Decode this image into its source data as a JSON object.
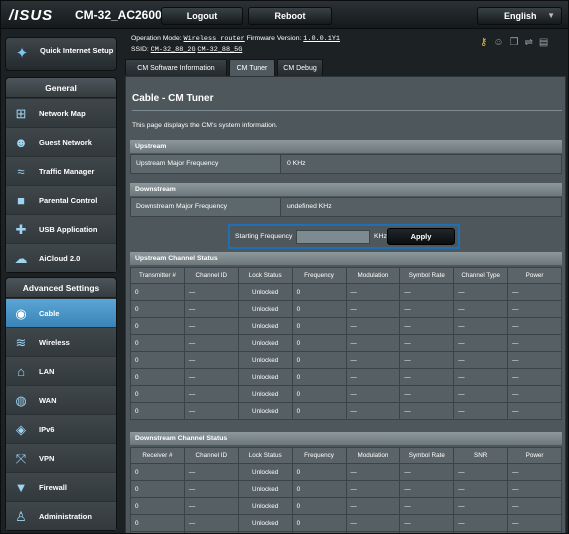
{
  "topbar": {
    "logo": "/ISUS",
    "model": "CM-32_AC2600",
    "logout": "Logout",
    "reboot": "Reboot",
    "language": "English"
  },
  "info": {
    "op_mode_label": "Operation Mode:",
    "op_mode_value": "Wireless router",
    "firmware_label": "Firmware Version:",
    "firmware_value": "1.0.0.1Y1",
    "ssid_label": "SSID:",
    "ssid_24": "CM-32_88_2G",
    "ssid_5": "CM-32_88_5G"
  },
  "nav": {
    "quick_setup": "Quick Internet Setup",
    "general_header": "General",
    "general": [
      {
        "label": "Network Map",
        "icon": "network-map-icon",
        "glyph": "⊞"
      },
      {
        "label": "Guest Network",
        "icon": "guest-network-icon",
        "glyph": "☻"
      },
      {
        "label": "Traffic Manager",
        "icon": "traffic-manager-icon",
        "glyph": "≈"
      },
      {
        "label": "Parental Control",
        "icon": "lock-icon",
        "glyph": "■"
      },
      {
        "label": "USB Application",
        "icon": "puzzle-icon",
        "glyph": "✚"
      },
      {
        "label": "AiCloud 2.0",
        "icon": "cloud-icon",
        "glyph": "☁"
      }
    ],
    "advanced_header": "Advanced Settings",
    "advanced": [
      {
        "label": "Cable",
        "icon": "cable-icon",
        "glyph": "◉",
        "active": true
      },
      {
        "label": "Wireless",
        "icon": "wireless-icon",
        "glyph": "≋"
      },
      {
        "label": "LAN",
        "icon": "home-icon",
        "glyph": "⌂"
      },
      {
        "label": "WAN",
        "icon": "globe-icon",
        "glyph": "◍"
      },
      {
        "label": "IPv6",
        "icon": "ipv6-icon",
        "glyph": "◈"
      },
      {
        "label": "VPN",
        "icon": "vpn-icon",
        "glyph": "⤧"
      },
      {
        "label": "Firewall",
        "icon": "shield-icon",
        "glyph": "▼"
      },
      {
        "label": "Administration",
        "icon": "person-icon",
        "glyph": "♙"
      }
    ]
  },
  "tabs": [
    "CM Software Information",
    "CM Tuner",
    "CM Debug"
  ],
  "page": {
    "title": "Cable - CM Tuner",
    "description": "This page displays the CM's system information.",
    "upstream_header": "Upstream",
    "upstream_label": "Upstream Major Frequency",
    "upstream_value": "0 KHz",
    "downstream_header": "Downstream",
    "downstream_label": "Downstream Major Frequency",
    "downstream_value": "undefined KHz",
    "starting_freq_label": "Starting Frequency",
    "starting_freq_value": "",
    "freq_unit": "KHz",
    "apply": "Apply"
  },
  "upstream_table": {
    "title": "Upstream Channel Status",
    "columns": [
      "Transmitter #",
      "Channel ID",
      "Lock Status",
      "Frequency",
      "Modulation",
      "Symbol Rate",
      "Channel Type",
      "Power"
    ],
    "rows": [
      [
        "0",
        "—",
        "Unlocked",
        "0",
        "—",
        "—",
        "—",
        "—"
      ],
      [
        "0",
        "—",
        "Unlocked",
        "0",
        "—",
        "—",
        "—",
        "—"
      ],
      [
        "0",
        "—",
        "Unlocked",
        "0",
        "—",
        "—",
        "—",
        "—"
      ],
      [
        "0",
        "—",
        "Unlocked",
        "0",
        "—",
        "—",
        "—",
        "—"
      ],
      [
        "0",
        "—",
        "Unlocked",
        "0",
        "—",
        "—",
        "—",
        "—"
      ],
      [
        "0",
        "—",
        "Unlocked",
        "0",
        "—",
        "—",
        "—",
        "—"
      ],
      [
        "0",
        "—",
        "Unlocked",
        "0",
        "—",
        "—",
        "—",
        "—"
      ],
      [
        "0",
        "—",
        "Unlocked",
        "0",
        "—",
        "—",
        "—",
        "—"
      ]
    ]
  },
  "downstream_table": {
    "title": "Downstream Channel Status",
    "columns": [
      "Receiver #",
      "Channel ID",
      "Lock Status",
      "Frequency",
      "Modulation",
      "Symbol Rate",
      "SNR",
      "Power"
    ],
    "rows": [
      [
        "0",
        "—",
        "Unlocked",
        "0",
        "—",
        "—",
        "—",
        "—"
      ],
      [
        "0",
        "—",
        "Unlocked",
        "0",
        "—",
        "—",
        "—",
        "—"
      ],
      [
        "0",
        "—",
        "Unlocked",
        "0",
        "—",
        "—",
        "—",
        "—"
      ],
      [
        "0",
        "—",
        "Unlocked",
        "0",
        "—",
        "—",
        "—",
        "—"
      ],
      [
        "0",
        "—",
        "Unlocked",
        "0",
        "—",
        "—",
        "—",
        "—"
      ]
    ]
  }
}
